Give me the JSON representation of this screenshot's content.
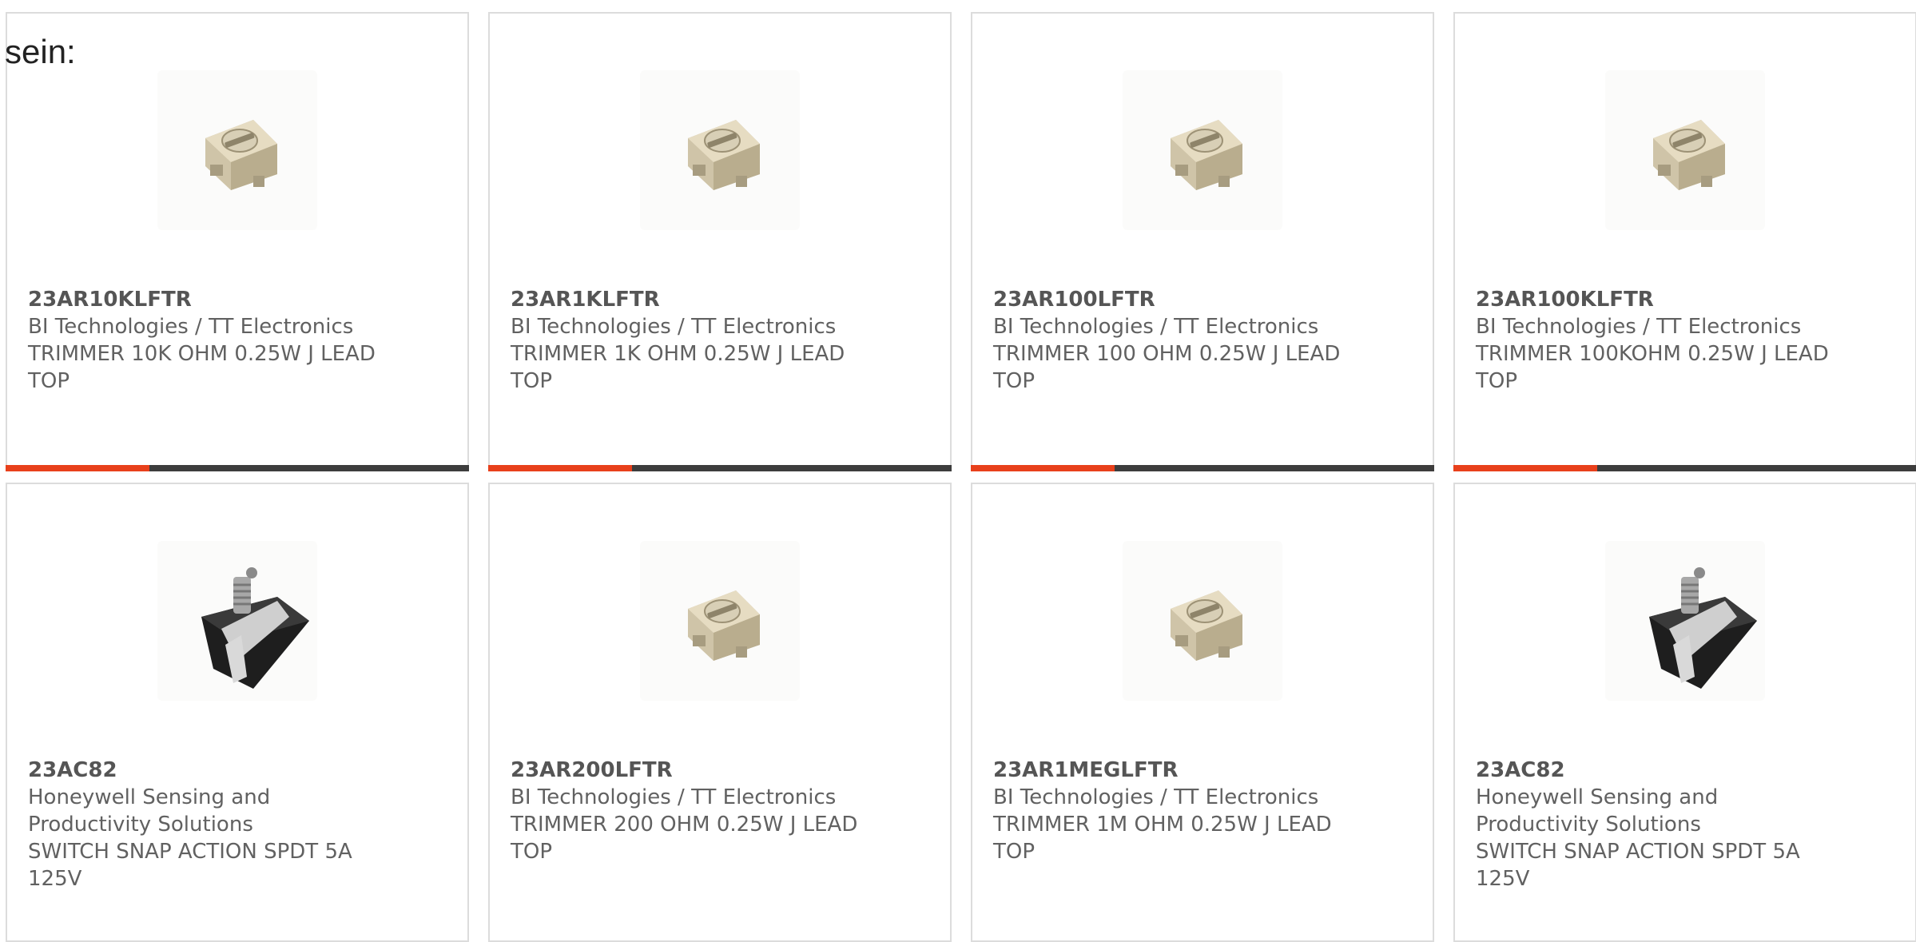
{
  "intro_text": "sein:",
  "colors": {
    "accent": "#e8401b",
    "bar_track": "#3d3d3d",
    "border": "#dcdcdc",
    "text": "#616161"
  },
  "products": [
    {
      "part_number": "23AR10KLFTR",
      "manufacturer": "BI Technologies / TT Electronics",
      "description": "TRIMMER 10K OHM 0.25W J LEAD TOP",
      "image": "trimmer-potentiometer-image",
      "highlight_fraction": 0.31
    },
    {
      "part_number": "23AR1KLFTR",
      "manufacturer": "BI Technologies / TT Electronics",
      "description": "TRIMMER 1K OHM 0.25W J LEAD TOP",
      "image": "trimmer-potentiometer-image",
      "highlight_fraction": 0.31
    },
    {
      "part_number": "23AR100LFTR",
      "manufacturer": "BI Technologies / TT Electronics",
      "description": "TRIMMER 100 OHM 0.25W J LEAD TOP",
      "image": "trimmer-potentiometer-image",
      "highlight_fraction": 0.31
    },
    {
      "part_number": "23AR100KLFTR",
      "manufacturer": "BI Technologies / TT Electronics",
      "description": "TRIMMER 100KOHM 0.25W J LEAD TOP",
      "image": "trimmer-potentiometer-image",
      "highlight_fraction": 0.31
    },
    {
      "part_number": "23AC82",
      "manufacturer": "Honeywell Sensing and Productivity Solutions",
      "description": "SWITCH SNAP ACTION SPDT 5A 125V",
      "image": "snap-action-switch-image"
    },
    {
      "part_number": "23AR200LFTR",
      "manufacturer": "BI Technologies / TT Electronics",
      "description": "TRIMMER 200 OHM 0.25W J LEAD TOP",
      "image": "trimmer-potentiometer-image"
    },
    {
      "part_number": "23AR1MEGLFTR",
      "manufacturer": "BI Technologies / TT Electronics",
      "description": "TRIMMER 1M OHM 0.25W J LEAD TOP",
      "image": "trimmer-potentiometer-image"
    },
    {
      "part_number": "23AC82",
      "manufacturer": "Honeywell Sensing and Productivity Solutions",
      "description": "SWITCH SNAP ACTION SPDT 5A 125V",
      "image": "snap-action-switch-image"
    }
  ]
}
